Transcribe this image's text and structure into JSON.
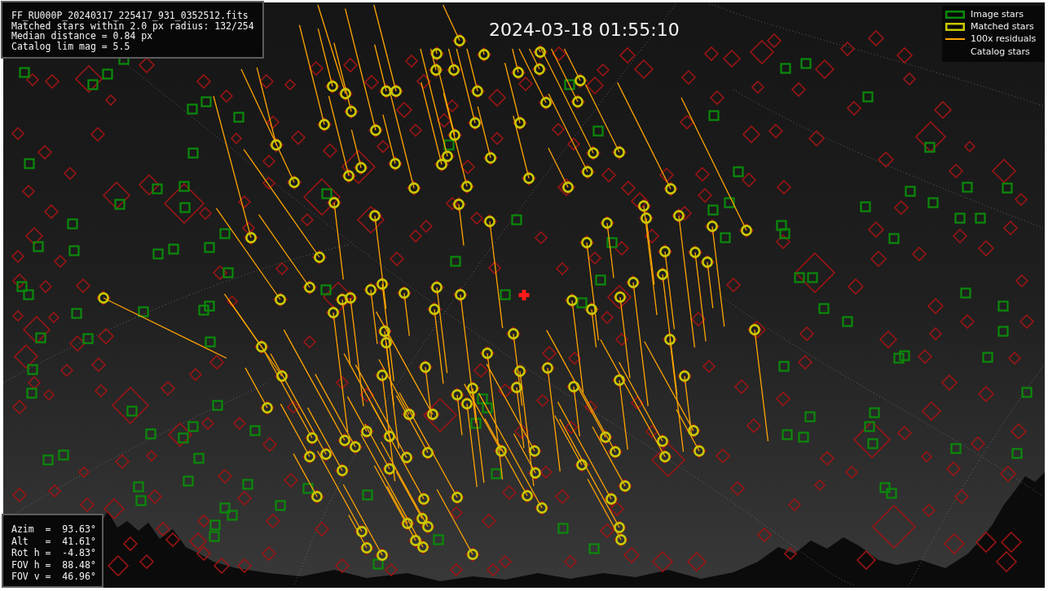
{
  "info_panel": {
    "lines": [
      "FF_RU000P_20240317_225417_931_0352512.fits",
      "Matched stars within 2.0 px radius: 132/254",
      "Median distance = 0.84 px",
      "Catalog lim mag = 5.5"
    ]
  },
  "frame_timestamp": "2024-03-18 01:55:10",
  "legend": {
    "items": [
      {
        "kind": "image_star",
        "label": "Image stars",
        "color": "#0b8a0b"
      },
      {
        "kind": "matched_star",
        "label": "Matched stars",
        "color": "#c8c800"
      },
      {
        "kind": "residual",
        "label": "100x residuals",
        "color": "#ffa500"
      },
      {
        "kind": "catalog_star",
        "label": "Catalog stars"
      }
    ]
  },
  "pointing_panel": {
    "lines": [
      "Azim  =  93.63°",
      "Alt   =  41.61°",
      "Rot h =  -4.83°",
      "FOV h =  88.48°",
      "FOV v =  46.96°"
    ]
  }
}
